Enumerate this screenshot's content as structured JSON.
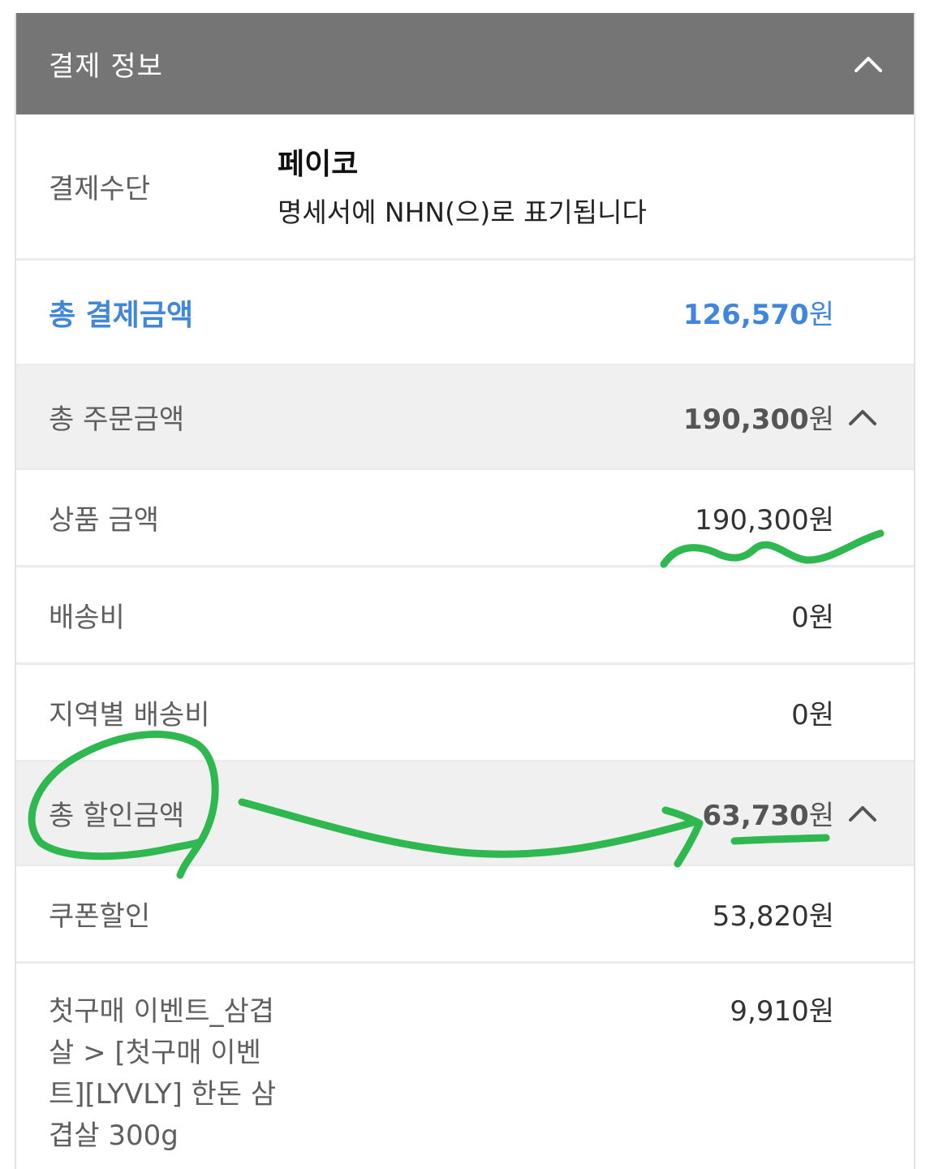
{
  "header": {
    "title": "결제 정보",
    "toggle_icon": "chevron-up-icon"
  },
  "payment_method": {
    "label": "결제수단",
    "name": "페이코",
    "note": "명세서에 NHN(으)로 표기됩니다"
  },
  "total_payment": {
    "label": "총 결제금액",
    "amount": "126,570",
    "unit": "원",
    "color": "#3f86dc"
  },
  "order_total": {
    "label": "총 주문금액",
    "amount": "190,300",
    "unit": "원",
    "items": [
      {
        "label": "상품 금액",
        "amount": "190,300",
        "unit": "원"
      },
      {
        "label": "배송비",
        "amount": "0",
        "unit": "원"
      },
      {
        "label": "지역별 배송비",
        "amount": "0",
        "unit": "원"
      }
    ]
  },
  "discount_total": {
    "label": "총 할인금액",
    "amount": "63,730",
    "unit": "원",
    "items": [
      {
        "label": "쿠폰할인",
        "amount": "53,820",
        "unit": "원"
      },
      {
        "label": "첫구매 이벤트_삼겹살 > [첫구매 이벤트][LYVLY] 한돈 삼겹살 300g",
        "amount": "9,910",
        "unit": "원"
      }
    ]
  },
  "annotation_color": "#2fb84f"
}
